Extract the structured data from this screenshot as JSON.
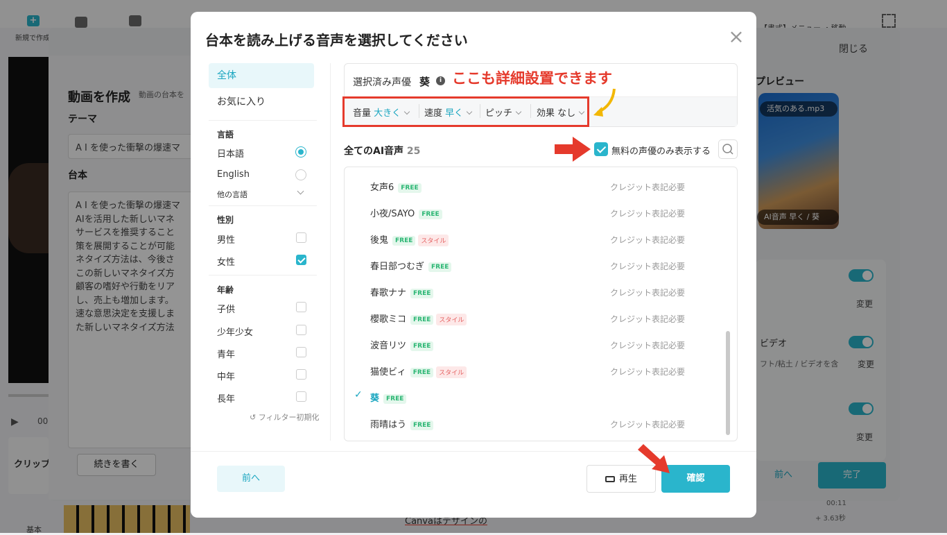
{
  "background": {
    "toolbar_new": "新規で作成",
    "toolbar_close": "閉じる",
    "toolbar_format": "【書式】メニュー ・移動",
    "panel_title": "動画を作成",
    "panel_sub": "動画の台本を",
    "theme_label": "テーマ",
    "theme_value": "A I を使った衝撃の爆速マ",
    "script_label": "台本",
    "script_text": "A I を使った衝撃の爆速マ\nAIを活用した新しいマネ\nサービスを推奨すること\n策を展開することが可能\nネタイズ方法は、今後さ\nこの新しいマネタイズ方\n顧客の嗜好や行動をリア\nし、売上も増加します。\n速な意思決定を支援しま\nた新しいマネタイズ方法",
    "continue_btn": "続きを書く",
    "preview_title": "プレビュー",
    "poster_tag": "活気のある.mp3",
    "poster_tag2": "AI音声 早く / 葵",
    "change": "変更",
    "video_label": "ビデオ",
    "video_sub": "フト/粘土 / ビデオを含",
    "prev_btn": "前へ",
    "done_btn": "完了",
    "clip_label": "クリップ",
    "timeline_time": "00",
    "basic_label": "基本",
    "canva_text": "Canvaはデザインの",
    "file_time": "00:11",
    "file_size": "+ 3.63秒"
  },
  "modal": {
    "title": "台本を読み上げる音声を選択してください",
    "filters": {
      "all": "全体",
      "favorites": "お気に入り",
      "language_head": "言語",
      "japanese": "日本語",
      "english": "English",
      "other_lang": "他の言語",
      "gender_head": "性別",
      "male": "男性",
      "female": "女性",
      "age_head": "年齢",
      "child": "子供",
      "youth": "少年少女",
      "young_adult": "青年",
      "middle": "中年",
      "senior": "長年",
      "reset": "フィルター初期化"
    },
    "selected": {
      "label": "選択済み声優",
      "voice": "葵",
      "annotation": "ここも詳細設置できます",
      "volume_label": "音量",
      "volume_value": "大きく",
      "speed_label": "速度",
      "speed_value": "早く",
      "pitch_label": "ピッチ",
      "effect_label": "効果",
      "effect_value": "なし"
    },
    "list_title": "全てのAI音声",
    "list_count": "25",
    "free_only": "無料の声優のみ表示する",
    "voices": [
      {
        "name": "女声6",
        "free": "FREE",
        "style": "",
        "credit": "クレジット表記必要"
      },
      {
        "name": "小夜/SAYO",
        "free": "FREE",
        "style": "",
        "credit": "クレジット表記必要"
      },
      {
        "name": "後鬼",
        "free": "FREE",
        "style": "スタイル",
        "credit": "クレジット表記必要"
      },
      {
        "name": "春日部つむぎ",
        "free": "FREE",
        "style": "",
        "credit": "クレジット表記必要"
      },
      {
        "name": "春歌ナナ",
        "free": "FREE",
        "style": "",
        "credit": "クレジット表記必要"
      },
      {
        "name": "櫻歌ミコ",
        "free": "FREE",
        "style": "スタイル",
        "credit": "クレジット表記必要"
      },
      {
        "name": "波音リツ",
        "free": "FREE",
        "style": "",
        "credit": "クレジット表記必要"
      },
      {
        "name": "猫使ビィ",
        "free": "FREE",
        "style": "スタイル",
        "credit": "クレジット表記必要"
      },
      {
        "name": "葵",
        "free": "FREE",
        "style": "",
        "credit": ""
      },
      {
        "name": "雨晴はう",
        "free": "FREE",
        "style": "",
        "credit": "クレジット表記必要"
      }
    ],
    "prev": "前へ",
    "play": "再生",
    "confirm": "確認"
  },
  "colors": {
    "accent": "#2ab5cc",
    "annotation": "#e53a2c",
    "free_badge": "#2bb673"
  }
}
